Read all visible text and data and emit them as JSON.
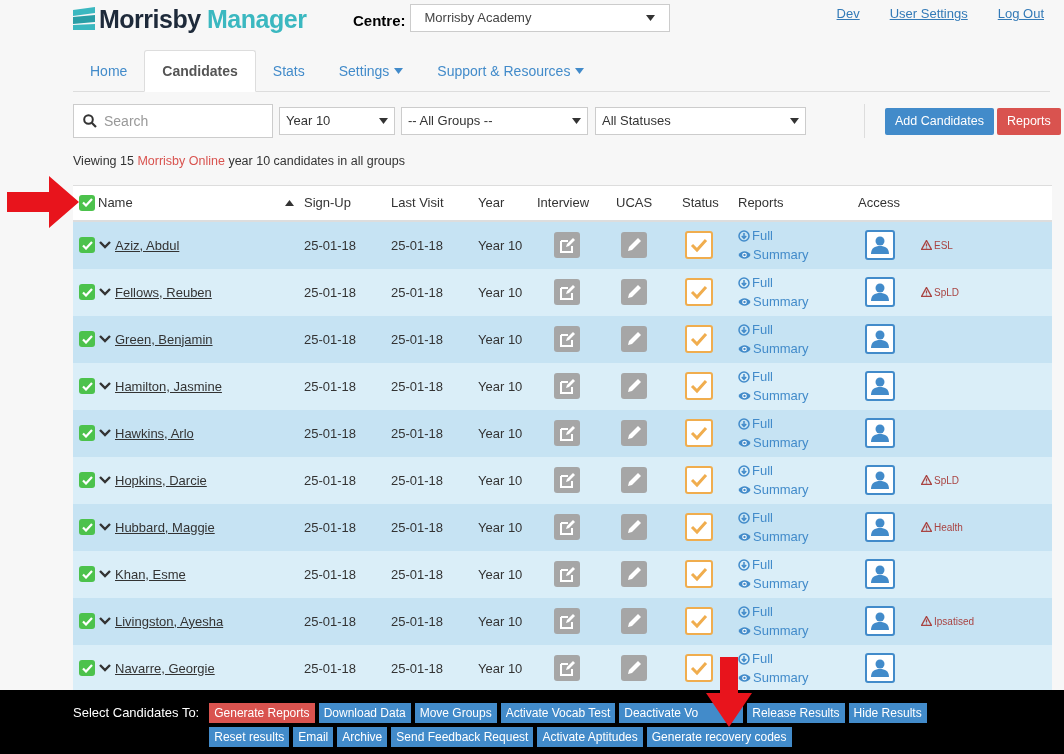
{
  "header": {
    "logo": {
      "word_1": "Morrisby",
      "word_2": "Manager"
    },
    "centre_label": "Centre:",
    "centre_value": "Morrisby Academy",
    "links": [
      "Dev",
      "User Settings",
      "Log Out"
    ]
  },
  "tabs": [
    {
      "label": "Home",
      "selected": false,
      "dropdown": false
    },
    {
      "label": "Candidates",
      "selected": true,
      "dropdown": false
    },
    {
      "label": "Stats",
      "selected": false,
      "dropdown": false
    },
    {
      "label": "Settings",
      "selected": false,
      "dropdown": true
    },
    {
      "label": "Support & Resources",
      "selected": false,
      "dropdown": true
    }
  ],
  "filters": {
    "search_placeholder": "Search",
    "year": "Year 10",
    "group": "-- All Groups --",
    "status": "All Statuses"
  },
  "actions": [
    {
      "label": "Add Candidates",
      "color": "#428bca"
    },
    {
      "label": "Reports",
      "color": "#d9534f"
    }
  ],
  "summary": {
    "before": "Viewing 15",
    "highlight": "Morrisby Online",
    "after": "year 10 candidates in all groups"
  },
  "table": {
    "select_all_checked": true,
    "sort_ascending": true,
    "columns": [
      "Name",
      "Sign-Up",
      "Last Visit",
      "Year",
      "Interview",
      "UCAS",
      "Status",
      "Reports",
      "Access"
    ],
    "rows": [
      {
        "checked": true,
        "name": "Aziz, Abdul",
        "sign_up": "25-01-18",
        "last_visit": "25-01-18",
        "year": "Year 10",
        "reports": [
          "Full",
          "Summary"
        ],
        "flag": "ESL"
      },
      {
        "checked": true,
        "name": "Fellows, Reuben",
        "sign_up": "25-01-18",
        "last_visit": "25-01-18",
        "year": "Year 10",
        "reports": [
          "Full",
          "Summary"
        ],
        "flag": "SpLD"
      },
      {
        "checked": true,
        "name": "Green, Benjamin",
        "sign_up": "25-01-18",
        "last_visit": "25-01-18",
        "year": "Year 10",
        "reports": [
          "Full",
          "Summary"
        ]
      },
      {
        "checked": true,
        "name": "Hamilton, Jasmine",
        "sign_up": "25-01-18",
        "last_visit": "25-01-18",
        "year": "Year 10",
        "reports": [
          "Full",
          "Summary"
        ]
      },
      {
        "checked": true,
        "name": "Hawkins, Arlo",
        "sign_up": "25-01-18",
        "last_visit": "25-01-18",
        "year": "Year 10",
        "reports": [
          "Full",
          "Summary"
        ]
      },
      {
        "checked": true,
        "name": "Hopkins, Darcie",
        "sign_up": "25-01-18",
        "last_visit": "25-01-18",
        "year": "Year 10",
        "reports": [
          "Full",
          "Summary"
        ],
        "flag": "SpLD"
      },
      {
        "checked": true,
        "name": "Hubbard, Maggie",
        "sign_up": "25-01-18",
        "last_visit": "25-01-18",
        "year": "Year 10",
        "reports": [
          "Full",
          "Summary"
        ],
        "flag": "Health"
      },
      {
        "checked": true,
        "name": "Khan, Esme",
        "sign_up": "25-01-18",
        "last_visit": "25-01-18",
        "year": "Year 10",
        "reports": [
          "Full",
          "Summary"
        ]
      },
      {
        "checked": true,
        "name": "Livingston, Ayesha",
        "sign_up": "25-01-18",
        "last_visit": "25-01-18",
        "year": "Year 10",
        "reports": [
          "Full",
          "Summary"
        ],
        "flag": "Ipsatised"
      },
      {
        "checked": true,
        "name": "Navarre, Georgie",
        "sign_up": "25-01-18",
        "last_visit": "25-01-18",
        "year": "Year 10",
        "reports": [
          "Full",
          "Summary"
        ]
      }
    ]
  },
  "bulk_actions": {
    "label": "Select Candidates To:",
    "buttons": [
      {
        "label": "Generate Reports",
        "color": "#d9534f"
      },
      {
        "label": "Download Data",
        "color": "#428bca"
      },
      {
        "label": "Move Groups",
        "color": "#428bca"
      },
      {
        "label": "Activate Vocab Test",
        "color": "#428bca"
      },
      {
        "label": "Deactivate Vo",
        "color": "#428bca"
      },
      {
        "label": "Release Results",
        "color": "#428bca"
      },
      {
        "label": "Hide Results",
        "color": "#428bca"
      },
      {
        "label": "Reset results",
        "color": "#428bca"
      },
      {
        "label": "Email",
        "color": "#428bca"
      },
      {
        "label": "Archive",
        "color": "#428bca"
      },
      {
        "label": "Send Feedback Request",
        "color": "#428bca"
      },
      {
        "label": "Activate Aptitudes",
        "color": "#428bca"
      },
      {
        "label": "Generate recovery codes",
        "color": "#428bca"
      }
    ]
  },
  "annotations": [
    {
      "kind": "arrow_right"
    },
    {
      "kind": "arrow_down"
    }
  ]
}
